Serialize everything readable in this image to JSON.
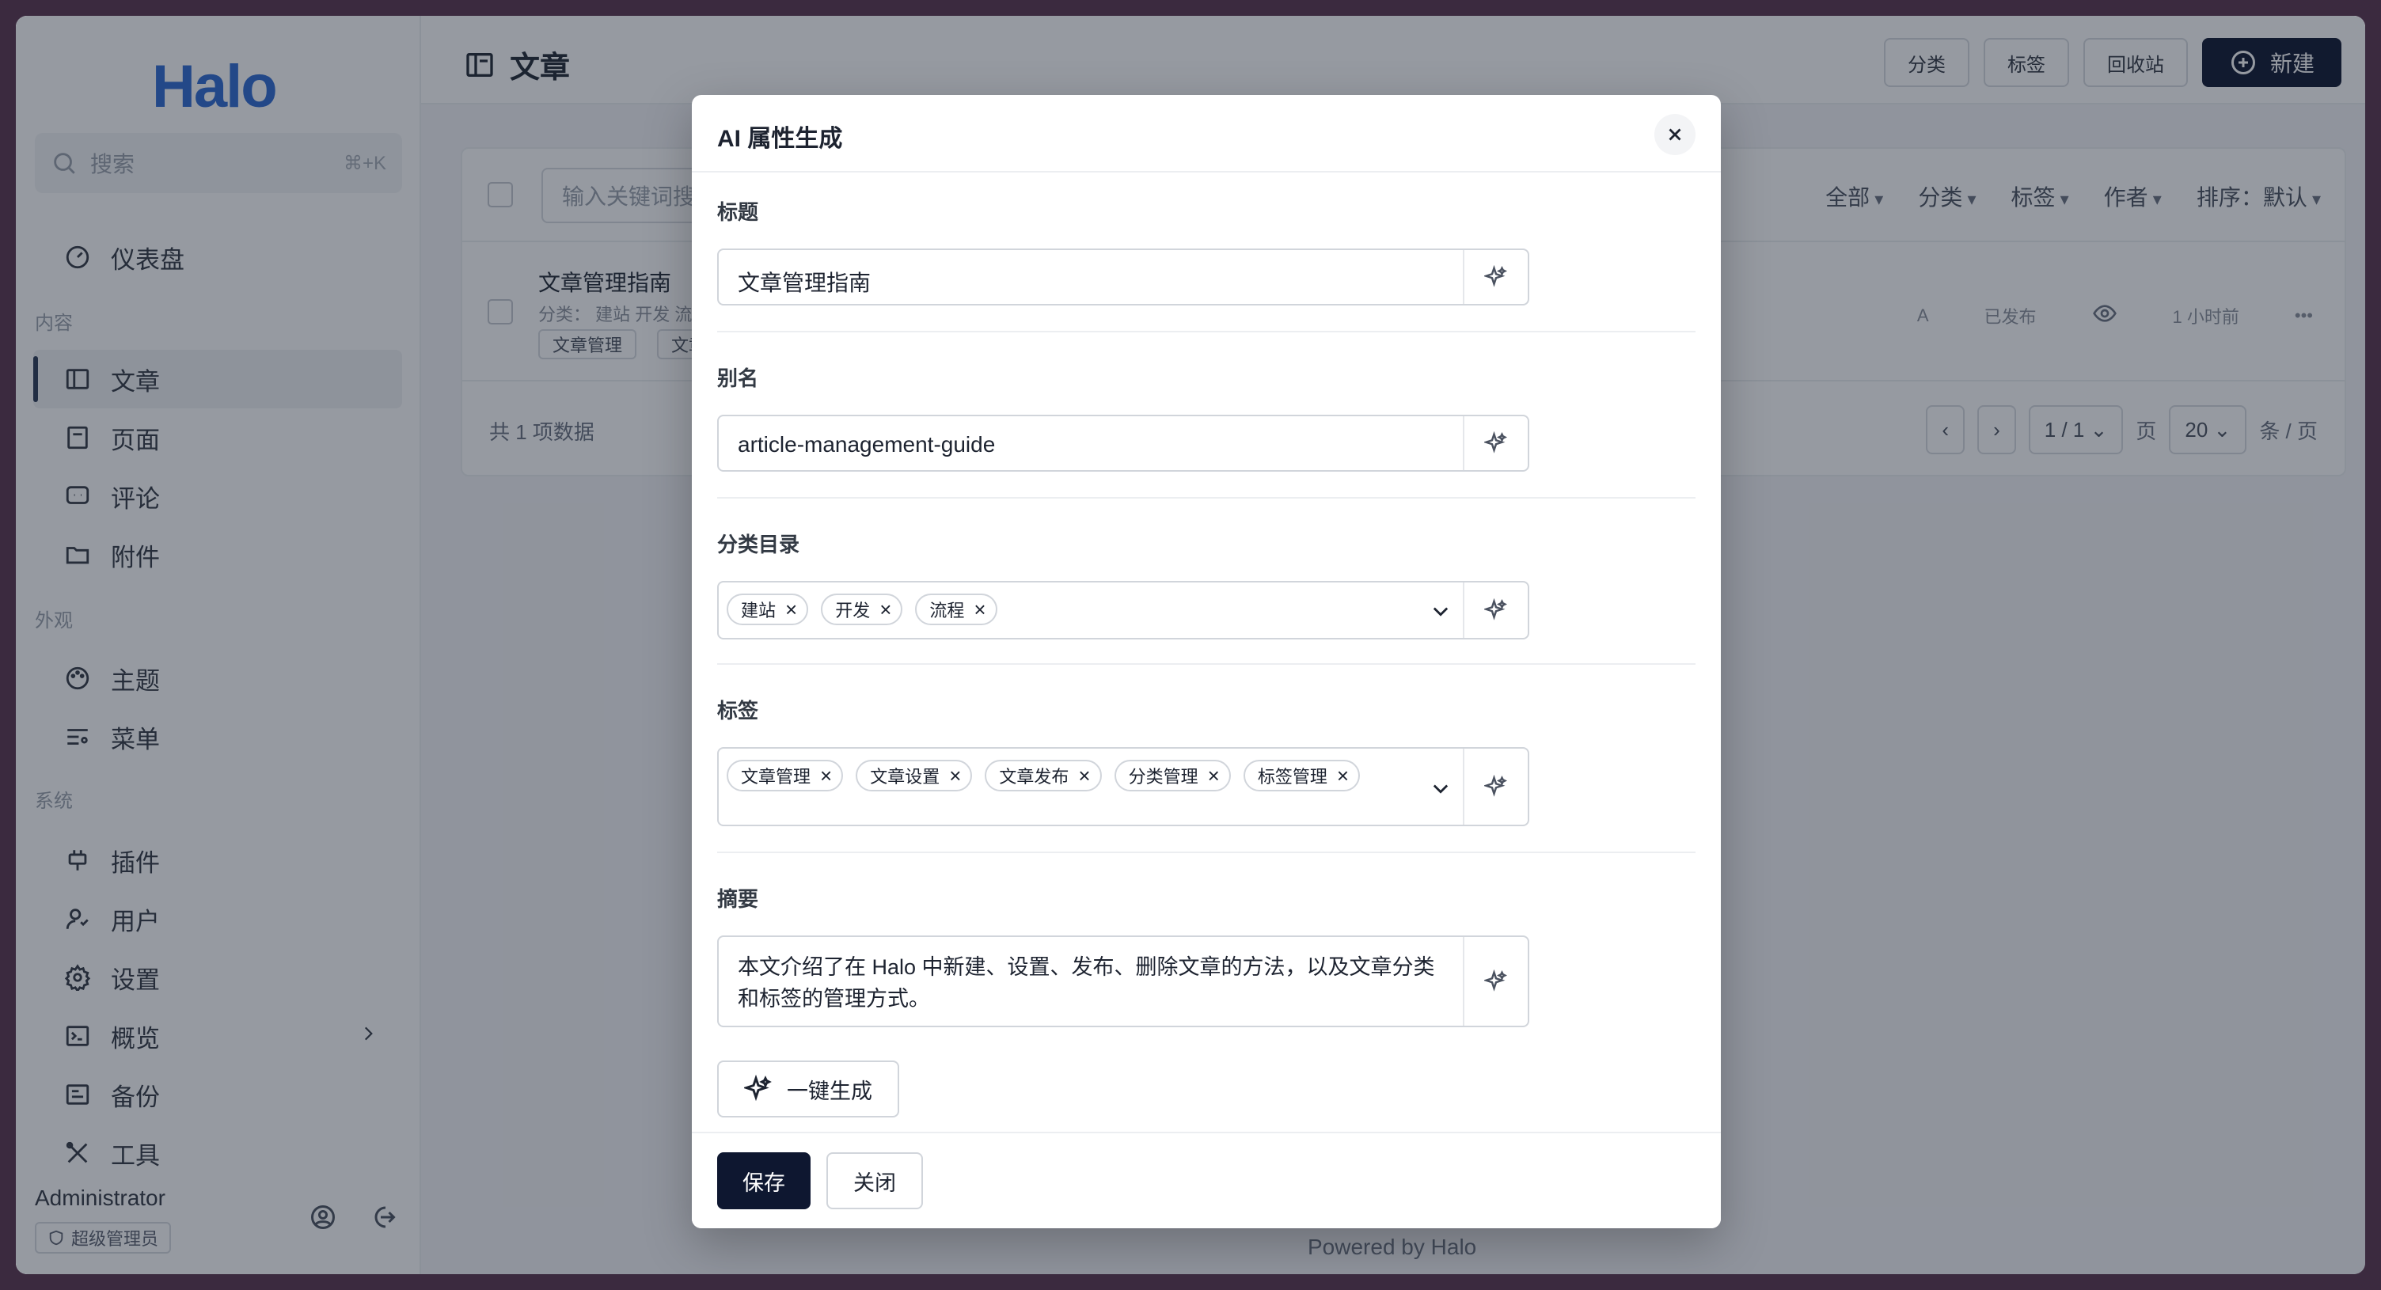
{
  "sidebar": {
    "logo": "Halo",
    "search_placeholder": "搜索",
    "search_shortcut": "⌘+K",
    "dashboard": "仪表盘",
    "section_content": "内容",
    "items_content": [
      "文章",
      "页面",
      "评论",
      "附件"
    ],
    "section_appearance": "外观",
    "items_appearance": [
      "主题",
      "菜单"
    ],
    "section_system": "系统",
    "items_system": [
      "插件",
      "用户",
      "设置",
      "概览",
      "备份",
      "工具"
    ],
    "user_name": "Administrator",
    "user_role": "超级管理员"
  },
  "header": {
    "title": "文章",
    "actions": [
      "分类",
      "标签",
      "回收站"
    ],
    "new_button": "新建"
  },
  "list": {
    "keyword_placeholder": "输入关键词搜索",
    "filters": [
      "全部",
      "分类",
      "标签",
      "作者",
      "排序：默认"
    ],
    "row": {
      "title": "文章管理指南",
      "meta": "分类： 建站 开发 流程",
      "chips": [
        "文章管理",
        "文章设置"
      ],
      "author_initial": "A",
      "status": "已发布",
      "time": "1 小时前"
    },
    "total": "共 1 项数据",
    "page_current": "1 / 1",
    "page_label": "页",
    "page_size": "20",
    "page_size_label": "条 / 页"
  },
  "footer": {
    "powered_prefix": "Powered by",
    "powered_brand": "Halo"
  },
  "modal": {
    "title": "AI 属性生成",
    "title_label": "标题",
    "title_value": "文章管理指南",
    "slug_label": "别名",
    "slug_value": "article-management-guide",
    "category_label": "分类目录",
    "categories": [
      "建站",
      "开发",
      "流程"
    ],
    "tags_label": "标签",
    "tags": [
      "文章管理",
      "文章设置",
      "文章发布",
      "分类管理",
      "标签管理"
    ],
    "summary_label": "摘要",
    "summary_value": "本文介绍了在 Halo 中新建、设置、发布、删除文章的方法，以及文章分类和标签的管理方式。",
    "generate_button": "一键生成",
    "save_button": "保存",
    "close_button": "关闭"
  }
}
